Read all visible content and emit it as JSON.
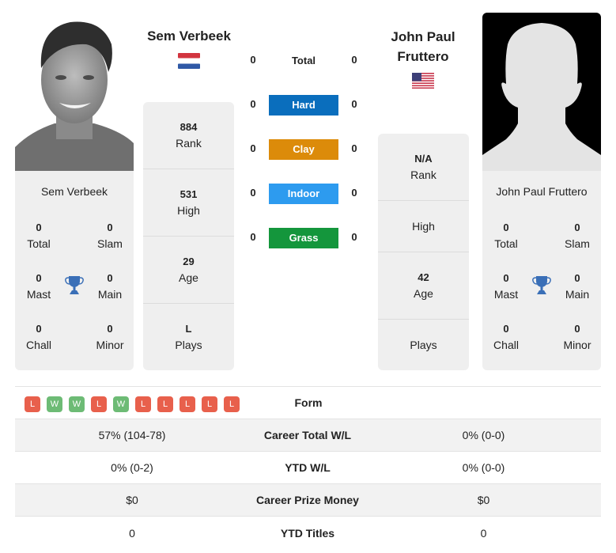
{
  "player1": {
    "name": "Sem Verbeek",
    "country_flag": "netherlands-flag",
    "photo": "player-photo",
    "rank": {
      "value": "884",
      "label": "Rank"
    },
    "high": {
      "value": "531",
      "label": "High"
    },
    "age": {
      "value": "29",
      "label": "Age"
    },
    "plays": {
      "value": "L",
      "label": "Plays"
    },
    "titles": {
      "total": {
        "value": "0",
        "label": "Total"
      },
      "slam": {
        "value": "0",
        "label": "Slam"
      },
      "mast": {
        "value": "0",
        "label": "Mast"
      },
      "main": {
        "value": "0",
        "label": "Main"
      },
      "chall": {
        "value": "0",
        "label": "Chall"
      },
      "minor": {
        "value": "0",
        "label": "Minor"
      }
    }
  },
  "player2": {
    "name": "John Paul Fruttero",
    "name_line1": "John Paul",
    "name_line2": "Fruttero",
    "country_flag": "usa-flag",
    "photo": "silhouette-placeholder",
    "rank": {
      "value": "N/A",
      "label": "Rank"
    },
    "high": {
      "value": "",
      "label": "High"
    },
    "age": {
      "value": "42",
      "label": "Age"
    },
    "plays": {
      "value": "",
      "label": "Plays"
    },
    "titles": {
      "total": {
        "value": "0",
        "label": "Total"
      },
      "slam": {
        "value": "0",
        "label": "Slam"
      },
      "mast": {
        "value": "0",
        "label": "Mast"
      },
      "main": {
        "value": "0",
        "label": "Main"
      },
      "chall": {
        "value": "0",
        "label": "Chall"
      },
      "minor": {
        "value": "0",
        "label": "Minor"
      }
    }
  },
  "h2h": {
    "total": {
      "label": "Total",
      "p1": "0",
      "p2": "0"
    },
    "surfaces": [
      {
        "label": "Hard",
        "p1": "0",
        "p2": "0",
        "color": "#0a6ebd"
      },
      {
        "label": "Clay",
        "p1": "0",
        "p2": "0",
        "color": "#dc8b0a"
      },
      {
        "label": "Indoor",
        "p1": "0",
        "p2": "0",
        "color": "#2d9bef"
      },
      {
        "label": "Grass",
        "p1": "0",
        "p2": "0",
        "color": "#14963c"
      }
    ]
  },
  "form": {
    "label": "Form",
    "results": [
      "L",
      "W",
      "W",
      "L",
      "W",
      "L",
      "L",
      "L",
      "L",
      "L"
    ]
  },
  "stats": [
    {
      "label": "Career Total W/L",
      "p1": "57% (104-78)",
      "p2": "0% (0-0)"
    },
    {
      "label": "YTD W/L",
      "p1": "0% (0-2)",
      "p2": "0% (0-0)"
    },
    {
      "label": "Career Prize Money",
      "p1": "$0",
      "p2": "$0"
    },
    {
      "label": "YTD Titles",
      "p1": "0",
      "p2": "0"
    }
  ],
  "colors": {
    "win": "#6dbb75",
    "loss": "#e8604c",
    "trophy": "#3a6fb7",
    "card_bg": "#efefef"
  }
}
